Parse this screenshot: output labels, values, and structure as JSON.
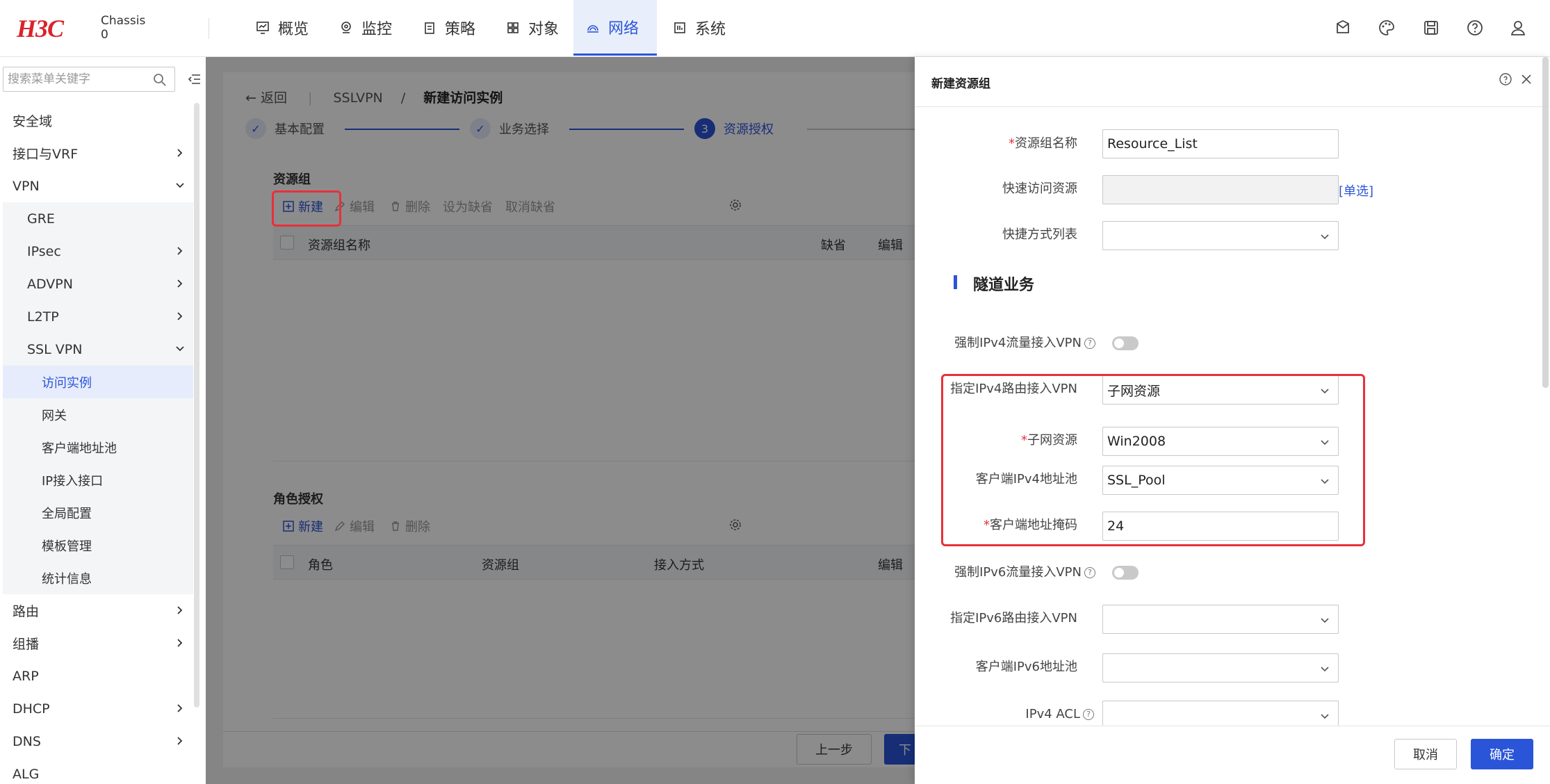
{
  "brand": {
    "logo": "H3C",
    "chassis_line1": "Chassis",
    "chassis_line2": "0"
  },
  "topnav": [
    {
      "label": "概览",
      "icon": "monitor-icon"
    },
    {
      "label": "监控",
      "icon": "location-icon"
    },
    {
      "label": "策略",
      "icon": "clipboard-icon"
    },
    {
      "label": "对象",
      "icon": "grid-icon"
    },
    {
      "label": "网络",
      "icon": "network-icon",
      "active": true
    },
    {
      "label": "系统",
      "icon": "system-icon"
    }
  ],
  "sidebar": {
    "search_placeholder": "搜索菜单关键字",
    "items": [
      {
        "label": "安全域",
        "level": 1
      },
      {
        "label": "接口与VRF",
        "level": 1,
        "chevron": "right"
      },
      {
        "label": "VPN",
        "level": 1,
        "chevron": "down"
      },
      {
        "label": "GRE",
        "level": 2
      },
      {
        "label": "IPsec",
        "level": 2,
        "chevron": "right"
      },
      {
        "label": "ADVPN",
        "level": 2,
        "chevron": "right"
      },
      {
        "label": "L2TP",
        "level": 2,
        "chevron": "right"
      },
      {
        "label": "SSL VPN",
        "level": 2,
        "chevron": "down"
      },
      {
        "label": "访问实例",
        "level": 3,
        "selected": true
      },
      {
        "label": "网关",
        "level": 3
      },
      {
        "label": "客户端地址池",
        "level": 3
      },
      {
        "label": "IP接入接口",
        "level": 3
      },
      {
        "label": "全局配置",
        "level": 3
      },
      {
        "label": "模板管理",
        "level": 3
      },
      {
        "label": "统计信息",
        "level": 3
      },
      {
        "label": "路由",
        "level": 1,
        "chevron": "right"
      },
      {
        "label": "组播",
        "level": 1,
        "chevron": "right"
      },
      {
        "label": "ARP",
        "level": 1
      },
      {
        "label": "DHCP",
        "level": 1,
        "chevron": "right"
      },
      {
        "label": "DNS",
        "level": 1,
        "chevron": "right"
      },
      {
        "label": "ALG",
        "level": 1
      }
    ]
  },
  "main": {
    "breadcrumb": {
      "back": "返回",
      "section": "SSLVPN",
      "sep": "/",
      "current": "新建访问实例"
    },
    "steps": [
      {
        "label": "基本配置",
        "state": "done"
      },
      {
        "label": "业务选择",
        "state": "done"
      },
      {
        "num": "3",
        "label": "资源授权",
        "state": "active"
      }
    ],
    "resource_group": {
      "title": "资源组",
      "toolbar": {
        "new": "新建",
        "edit": "编辑",
        "delete": "删除",
        "set_default": "设为缺省",
        "cancel_default": "取消缺省"
      },
      "columns": [
        "资源组名称",
        "缺省",
        "编辑"
      ]
    },
    "role_auth": {
      "title": "角色授权",
      "toolbar": {
        "new": "新建",
        "edit": "编辑",
        "delete": "删除"
      },
      "columns": [
        "角色",
        "资源组",
        "接入方式",
        "编辑"
      ]
    },
    "footer": {
      "prev": "上一步",
      "next": "下"
    }
  },
  "drawer": {
    "title": "新建资源组",
    "fields": {
      "name_label": "资源组名称",
      "name_value": "Resource_List",
      "quick_label": "快速访问资源",
      "quick_link": "[单选]",
      "shortcut_label": "快捷方式列表",
      "shortcut_value": ""
    },
    "tunnel_section": "隧道业务",
    "tunnel": {
      "force_ipv4_label": "强制IPv4流量接入VPN",
      "force_ipv4_on": false,
      "route_ipv4_label": "指定IPv4路由接入VPN",
      "route_ipv4_value": "子网资源",
      "subnet_label": "子网资源",
      "subnet_value": "Win2008",
      "pool_ipv4_label": "客户端IPv4地址池",
      "pool_ipv4_value": "SSL_Pool",
      "mask_label": "客户端地址掩码",
      "mask_value": "24",
      "force_ipv6_label": "强制IPv6流量接入VPN",
      "force_ipv6_on": false,
      "route_ipv6_label": "指定IPv6路由接入VPN",
      "route_ipv6_value": "",
      "pool_ipv6_label": "客户端IPv6地址池",
      "pool_ipv6_value": "",
      "acl_label": "IPv4 ACL",
      "acl_value": ""
    },
    "buttons": {
      "cancel": "取消",
      "ok": "确定"
    }
  },
  "colors": {
    "accent": "#2b55d8",
    "highlight": "#e8303b",
    "brand": "#d9232d"
  }
}
